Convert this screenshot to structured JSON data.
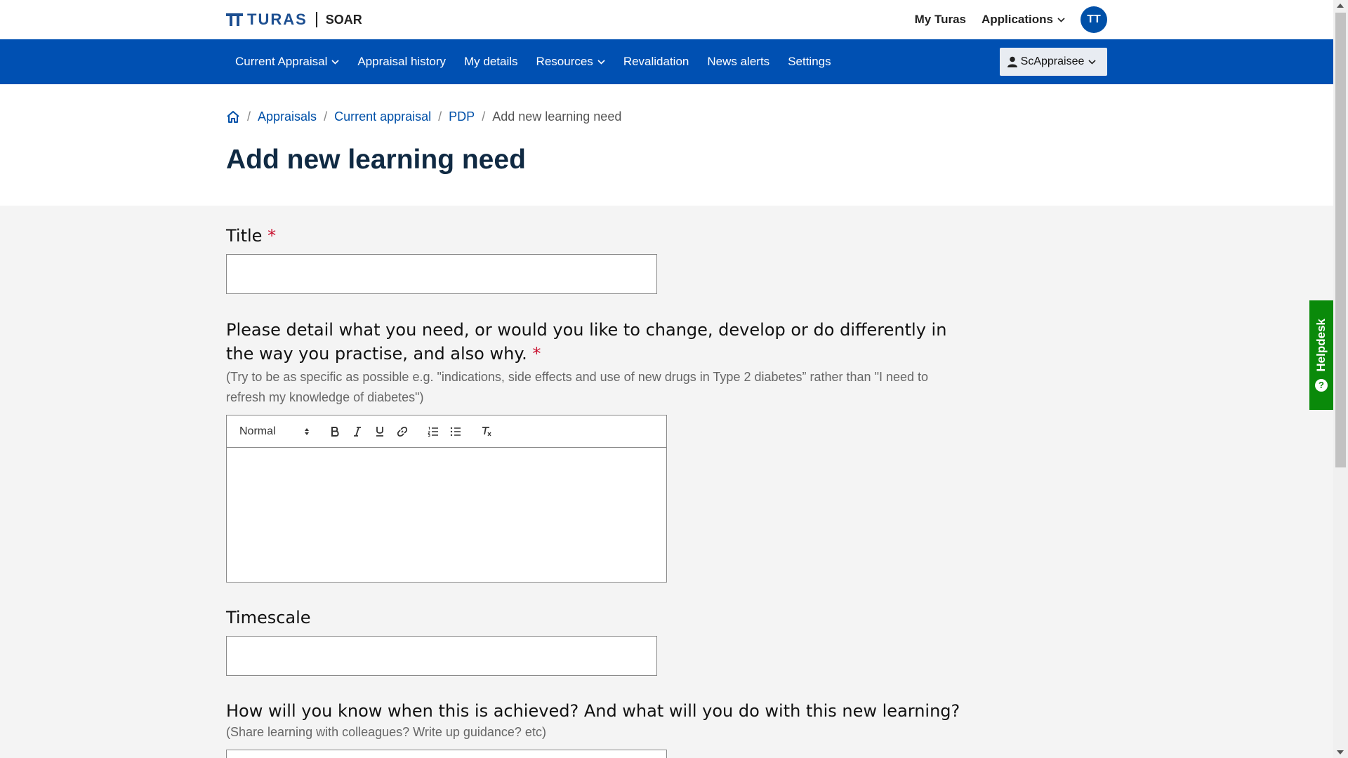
{
  "header": {
    "brand_name": "TURAS",
    "app_name": "SOAR",
    "links": [
      "My Turas",
      "Applications"
    ],
    "avatar_initials": "TT"
  },
  "nav": {
    "items": [
      "Current Appraisal",
      "Appraisal history",
      "My details",
      "Resources",
      "Revalidation",
      "News alerts",
      "Settings"
    ],
    "role_label": "ScAppraisee"
  },
  "breadcrumb": {
    "items": [
      "Appraisals",
      "Current appraisal",
      "PDP"
    ],
    "current": "Add new learning need"
  },
  "page": {
    "title": "Add new learning need"
  },
  "form": {
    "title_label": "Title",
    "title_required": "*",
    "title_value": "",
    "need_label": "Please detail what you need, or would you like to change, develop or do differently in the way you practise, and also why.",
    "need_required": "*",
    "need_hint": "(Try to be as specific as possible e.g. \"indications, side effects and use of new drugs in Type 2 diabetes” rather than \"I need to refresh my knowledge of diabetes\")",
    "editor_format": "Normal",
    "timescale_label": "Timescale",
    "timescale_value": "",
    "achieved_label": "How will you know when this is achieved? And what will you do with this new learning?",
    "achieved_hint": "(Share learning with colleagues? Write up guidance? etc)"
  },
  "helpdesk": {
    "label": "Helpdesk",
    "icon": "?"
  },
  "colors": {
    "brand_blue": "#0050b2",
    "required_red": "#c8102e",
    "helpdesk_green": "#0a8a0a"
  }
}
